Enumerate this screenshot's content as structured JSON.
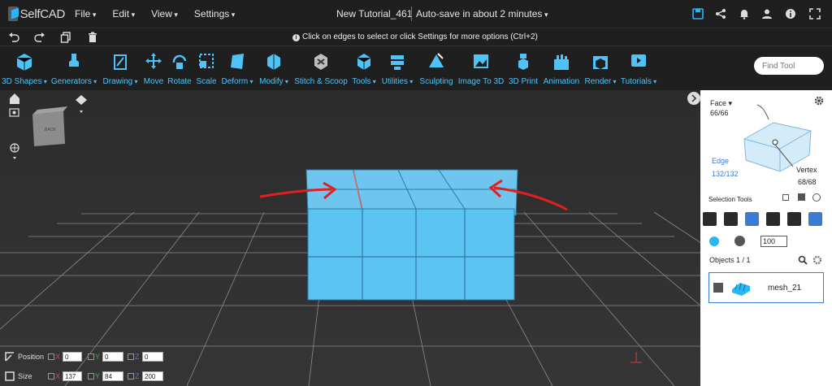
{
  "app": {
    "logo_text": "SelfCAD",
    "brand_color": "#29b6f6",
    "accent_color": "#4fc3f7"
  },
  "menubar": {
    "menus": [
      "File",
      "Edit",
      "View",
      "Settings"
    ],
    "tutorial_title": "New Tutorial_461",
    "autosave": "Auto-save in about 2 minutes",
    "right_icons": [
      "save-icon",
      "share-icon",
      "bell-icon",
      "user-icon",
      "info-icon",
      "fullscreen-icon"
    ]
  },
  "actionbar": {
    "icons": [
      "undo-icon",
      "redo-icon",
      "copy-icon",
      "delete-icon"
    ],
    "hint": "Click on edges to select or click Settings for more options (Ctrl+2)"
  },
  "toolbar": {
    "tools": [
      {
        "label": "3D Shapes",
        "dropdown": true,
        "icon": "cube-icon"
      },
      {
        "label": "Generators",
        "dropdown": true,
        "icon": "generator-icon"
      },
      {
        "label": "Drawing",
        "dropdown": true,
        "icon": "drawing-icon"
      },
      {
        "label": "Move",
        "dropdown": false,
        "icon": "move-icon"
      },
      {
        "label": "Rotate",
        "dropdown": false,
        "icon": "rotate-icon"
      },
      {
        "label": "Scale",
        "dropdown": false,
        "icon": "scale-icon"
      },
      {
        "label": "Deform",
        "dropdown": true,
        "icon": "deform-icon"
      },
      {
        "label": "Modify",
        "dropdown": true,
        "icon": "modify-icon"
      },
      {
        "label": "Stitch & Scoop",
        "dropdown": false,
        "icon": "stitch-icon"
      },
      {
        "label": "Tools",
        "dropdown": true,
        "icon": "tools-icon"
      },
      {
        "label": "Utilities",
        "dropdown": true,
        "icon": "utilities-icon"
      },
      {
        "label": "Sculpting",
        "dropdown": false,
        "icon": "sculpt-icon"
      },
      {
        "label": "Image To 3D",
        "dropdown": false,
        "icon": "image-icon"
      },
      {
        "label": "3D Print",
        "dropdown": false,
        "icon": "print-icon"
      },
      {
        "label": "Animation",
        "dropdown": false,
        "icon": "animation-icon"
      },
      {
        "label": "Render",
        "dropdown": true,
        "icon": "render-icon"
      },
      {
        "label": "Tutorials",
        "dropdown": true,
        "icon": "tutorials-icon"
      }
    ],
    "find_placeholder": "Find Tool"
  },
  "viewcube": {
    "label": "BACK"
  },
  "panel": {
    "face_label": "Face",
    "face_count": "66/66",
    "edge_label": "Edge",
    "edge_count": "132/132",
    "vertex_label": "Vertex",
    "vertex_count": "68/68",
    "selection_tools_label": "Selection Tools",
    "value": "100",
    "objects_label": "Objects 1 / 1",
    "object_name": "mesh_21"
  },
  "transform": {
    "position_label": "Position",
    "size_label": "Size",
    "position": {
      "x": "0",
      "y": "0",
      "z": "0"
    },
    "size": {
      "x": "137",
      "y": "84",
      "z": "200"
    },
    "axis_labels": [
      "X",
      "Y",
      "Z"
    ]
  }
}
